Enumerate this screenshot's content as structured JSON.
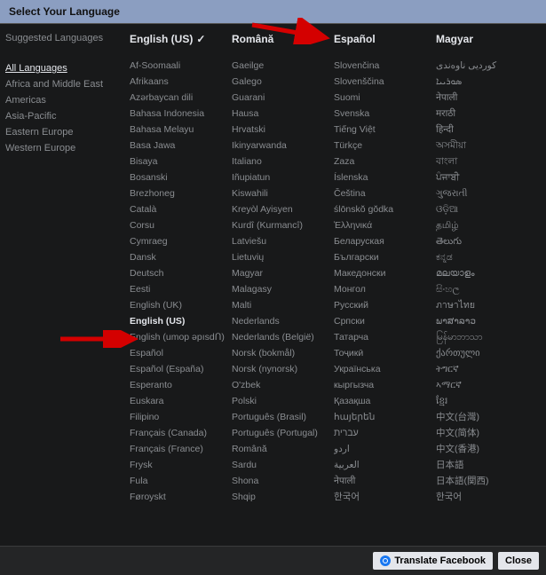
{
  "header": {
    "title": "Select Your Language"
  },
  "sidebar": {
    "suggested_label": "Suggested Languages",
    "categories": [
      {
        "label": "All Languages",
        "active": true
      },
      {
        "label": "Africa and Middle East",
        "active": false
      },
      {
        "label": "Americas",
        "active": false
      },
      {
        "label": "Asia-Pacific",
        "active": false
      },
      {
        "label": "Eastern Europe",
        "active": false
      },
      {
        "label": "Western Europe",
        "active": false
      }
    ]
  },
  "suggested": [
    {
      "label": "English (US)",
      "selected": true
    },
    {
      "label": "Română",
      "selected": false
    },
    {
      "label": "Español",
      "selected": false
    },
    {
      "label": "Magyar",
      "selected": false
    }
  ],
  "columns": [
    [
      "Af-Soomaali",
      "Afrikaans",
      "Azərbaycan dili",
      "Bahasa Indonesia",
      "Bahasa Melayu",
      "Basa Jawa",
      "Bisaya",
      "Bosanski",
      "Brezhoneg",
      "Català",
      "Corsu",
      "Cymraeg",
      "Dansk",
      "Deutsch",
      "Eesti",
      "English (UK)",
      "English (US)",
      "English (umop əpısdՈ)",
      "Español",
      "Español (España)",
      "Esperanto",
      "Euskara",
      "Filipino",
      "Français (Canada)",
      "Français (France)",
      "Frysk",
      "Fula",
      "Føroyskt"
    ],
    [
      "Gaeilge",
      "Galego",
      "Guarani",
      "Hausa",
      "Hrvatski",
      "Ikinyarwanda",
      "Italiano",
      "Iñupiatun",
      "Kiswahili",
      "Kreyòl Ayisyen",
      "Kurdî (Kurmancî)",
      "Latviešu",
      "Lietuvių",
      "Magyar",
      "Malagasy",
      "Malti",
      "Nederlands",
      "Nederlands (België)",
      "Norsk (bokmål)",
      "Norsk (nynorsk)",
      "O'zbek",
      "Polski",
      "Português (Brasil)",
      "Português (Portugal)",
      "Română",
      "Sardu",
      "Shona",
      "Shqip"
    ],
    [
      "Slovenčina",
      "Slovenščina",
      "Suomi",
      "Svenska",
      "Tiếng Việt",
      "Türkçe",
      "Zaza",
      "Íslenska",
      "Čeština",
      "ślōnskŏ gŏdka",
      "Ἑλληνικά",
      "Беларуская",
      "Български",
      "Македонски",
      "Монгол",
      "Русский",
      "Српски",
      "Татарча",
      "Тоҷикӣ",
      "Українська",
      "кыргызча",
      "Қазақша",
      "հայերեն",
      "עברית",
      "اردو",
      "العربية",
      "नेपाली",
      "한국어"
    ],
    [
      "کوردیی ناوەندی",
      "ܣܘܪܝܝܐ",
      "नेपाली",
      "मराठी",
      "हिन्दी",
      "অসমীয়া",
      "বাংলা",
      "ਪੰਜਾਬੀ",
      "ગુજરાતી",
      "ଓଡ଼ିଆ",
      "தமிழ்",
      "తెలుగు",
      "ಕನ್ನಡ",
      "മലയാളം",
      "සිංහල",
      "ภาษาไทย",
      "ພາສາລາວ",
      "မြန်မာဘာသာ",
      "ქართული",
      "ትግርኛ",
      "ኣማርኛ",
      "ខ្មែរ",
      "中文(台灣)",
      "中文(简体)",
      "中文(香港)",
      "日本語",
      "日本語(関西)",
      "한국어"
    ]
  ],
  "selected_in_list": "English (US)",
  "footer": {
    "translate_label": "Translate Facebook",
    "close_label": "Close"
  }
}
